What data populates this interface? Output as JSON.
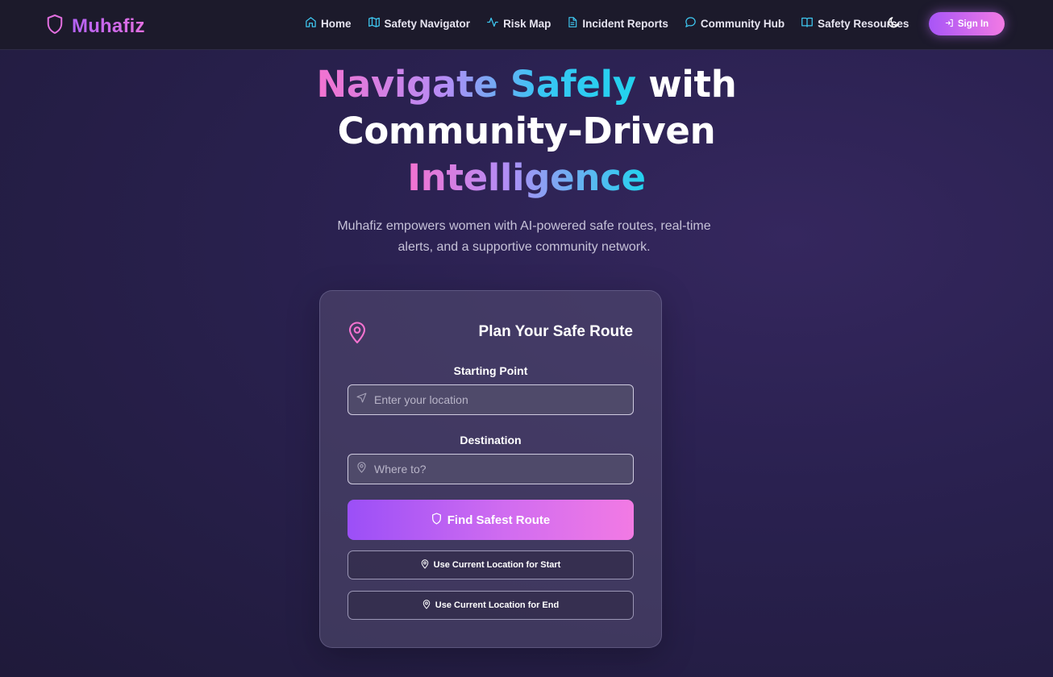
{
  "brand": {
    "name": "Muhafiz",
    "icon": "shield-icon"
  },
  "nav": {
    "items": [
      {
        "label": "Home",
        "icon": "home-icon"
      },
      {
        "label": "Safety Navigator",
        "icon": "map-icon"
      },
      {
        "label": "Risk Map",
        "icon": "activity-icon"
      },
      {
        "label": "Incident Reports",
        "icon": "document-icon"
      },
      {
        "label": "Community Hub",
        "icon": "chat-icon"
      },
      {
        "label": "Safety Resources",
        "icon": "book-icon"
      }
    ],
    "theme_toggle_icon": "moon-icon",
    "signin_label": "Sign In"
  },
  "hero": {
    "title_part1": "Navigate Safely",
    "title_part2": " with",
    "title_line2": "Community-Driven",
    "title_line3": "Intelligence",
    "subtitle": "Muhafiz empowers women with AI-powered safe routes, real-time alerts, and a supportive community network."
  },
  "route_card": {
    "title": "Plan Your Safe Route",
    "start_label": "Starting Point",
    "start_placeholder": "Enter your location",
    "start_value": "",
    "dest_label": "Destination",
    "dest_placeholder": "Where to?",
    "dest_value": "",
    "find_label": "Find Safest Route",
    "use_start_label": "Use Current Location for Start",
    "use_end_label": "Use Current Location for End"
  },
  "colors": {
    "accent_purple": "#a855f7",
    "accent_pink": "#f27ae4",
    "accent_cyan": "#22d3ee",
    "nav_bg": "#1c1a2b"
  }
}
